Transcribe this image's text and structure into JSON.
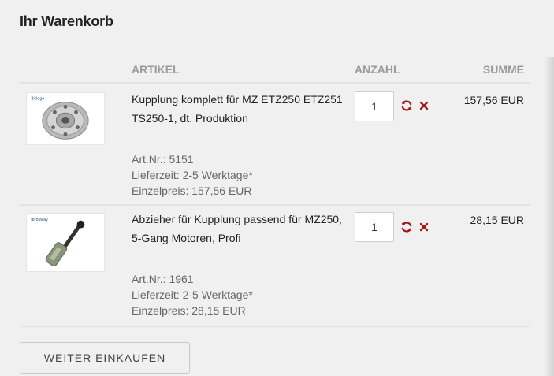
{
  "cart": {
    "title": "Ihr Warenkorb",
    "columns": {
      "article": "ARTIKEL",
      "quantity": "ANZAHL",
      "total": "SUMME"
    },
    "items": [
      {
        "name_line1": "Kupplung komplett für MZ ETZ250 ETZ251",
        "name_line2": "TS250-1, dt. Produktion",
        "art_nr": "Art.Nr.: 5151",
        "lieferzeit": "Lieferzeit: 2-5 Werktage*",
        "einzelpreis": "Einzelpreis: 157,56 EUR",
        "quantity": "1",
        "total": "157,56 EUR",
        "image_icon": "clutch-assembly-image",
        "image_logo": "Bitlogo"
      },
      {
        "name_line1": "Abzieher für Kupplung passend für MZ250,",
        "name_line2": "5-Gang Motoren, Profi",
        "art_nr": "Art.Nr.: 1961",
        "lieferzeit": "Lieferzeit: 2-5 Werktage*",
        "einzelpreis": "Einzelpreis: 28,15 EUR",
        "quantity": "1",
        "total": "28,15 EUR",
        "image_icon": "clutch-puller-tool-image",
        "image_logo": "Ibrosway"
      }
    ],
    "actions": {
      "refresh_icon": "refresh-icon",
      "remove_icon": "remove-icon",
      "continue_label": "WEITER EINKAUFEN"
    }
  },
  "colors": {
    "background": "#f0f0f0",
    "action_red": "#a01818",
    "header_gray": "#9a9a9a",
    "meta_gray": "#666666"
  }
}
